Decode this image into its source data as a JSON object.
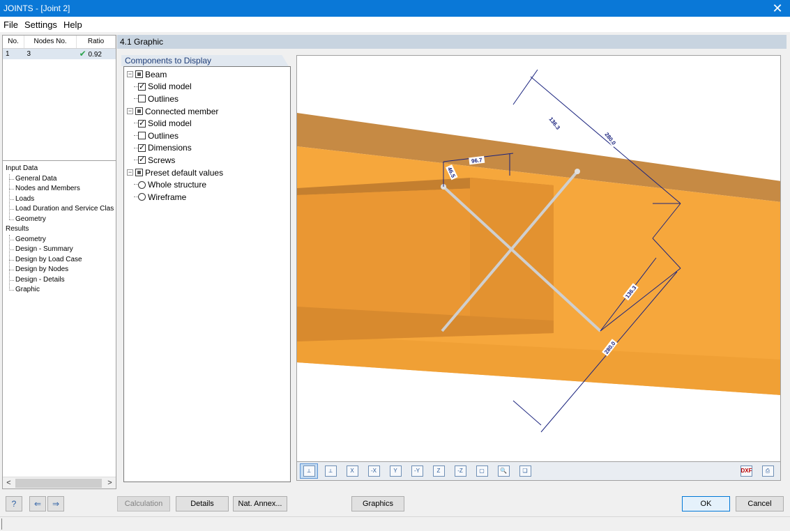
{
  "window": {
    "title": "JOINTS - [Joint 2]"
  },
  "menu": [
    "File",
    "Settings",
    "Help"
  ],
  "joints_table": {
    "headers": [
      "No.",
      "Nodes No.",
      "Ratio"
    ],
    "rows": [
      {
        "no": "1",
        "nodes": "3",
        "ratio": "0.92"
      }
    ]
  },
  "nav": {
    "input_title": "Input Data",
    "input_items": [
      "General Data",
      "Nodes and Members",
      "Loads",
      "Load Duration and Service Clas",
      "Geometry"
    ],
    "results_title": "Results",
    "results_items": [
      "Geometry",
      "Design - Summary",
      "Design by Load Case",
      "Design by Nodes",
      "Design - Details",
      "Graphic"
    ]
  },
  "section": {
    "title": "4.1 Graphic"
  },
  "components": {
    "tab_label": "Components to Display",
    "beam": {
      "label": "Beam",
      "solid": "Solid model",
      "outlines": "Outlines"
    },
    "member": {
      "label": "Connected member",
      "solid": "Solid model",
      "outlines": "Outlines",
      "dimensions": "Dimensions",
      "screws": "Screws"
    },
    "preset": {
      "label": "Preset default values",
      "whole": "Whole structure",
      "wireframe": "Wireframe"
    }
  },
  "dimensions": {
    "d1": "136.3",
    "d2": "280.0",
    "d3": "96.7",
    "d4": "46.5",
    "d5": "136.3",
    "d6": "280.0"
  },
  "buttons": {
    "calculation": "Calculation",
    "details": "Details",
    "nat_annex": "Nat. Annex...",
    "graphics": "Graphics",
    "ok": "OK",
    "cancel": "Cancel"
  },
  "toolbar": {
    "dxf": "DXF"
  },
  "colors": {
    "title_bar": "#0a78d7",
    "beam": "#f5a623",
    "beam_dark": "#c68a3a",
    "dimension": "#1a237e"
  }
}
